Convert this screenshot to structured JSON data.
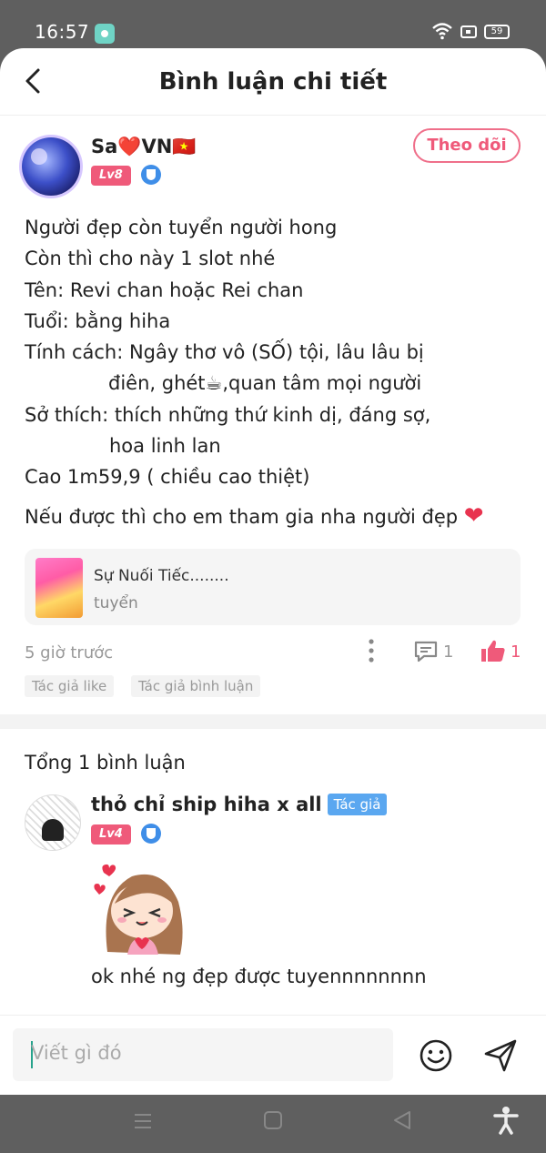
{
  "status": {
    "time": "16:57",
    "battery": "59"
  },
  "header": {
    "title": "Bình luận chi tiết"
  },
  "post": {
    "author": "Sa❤️VN🇻🇳",
    "level": "Lv8",
    "follow_label": "Theo dõi",
    "lines": [
      "Người đẹp còn tuyển người hong",
      "Còn thì cho này 1 slot nhé",
      "Tên: Revi chan hoặc Rei chan",
      "Tuổi: bằng hiha",
      "Tính cách: Ngây thơ vô (SỐ) tội, lâu lâu bị",
      "điên, ghét☕,quan tâm mọi người",
      "Sở thích: thích những thứ kinh dị, đáng sợ,",
      "hoa linh lan",
      "Cao 1m59,9 ( chiều cao thiệt)"
    ],
    "closing": "Nếu được thì cho em tham gia nha người đẹp",
    "quote": {
      "title": "Sự Nuối Tiếc........",
      "subtitle": "tuyển"
    },
    "time_ago": "5 giờ trước",
    "comment_count": "1",
    "like_count": "1",
    "tags": [
      "Tác giả like",
      "Tác giả bình luận"
    ]
  },
  "comments": {
    "total": "Tổng 1 bình luận",
    "items": [
      {
        "author": "thỏ chỉ ship hiha x all",
        "author_tag": "Tác giả",
        "level": "Lv4",
        "text": "ok nhé ng đẹp được tuyennnnnnnn"
      }
    ]
  },
  "composer": {
    "placeholder": "Viết gì đó"
  },
  "colors": {
    "accent": "#ef5a7a",
    "author_tag": "#5aa7f0",
    "level_badge": "#ef5a7a"
  }
}
